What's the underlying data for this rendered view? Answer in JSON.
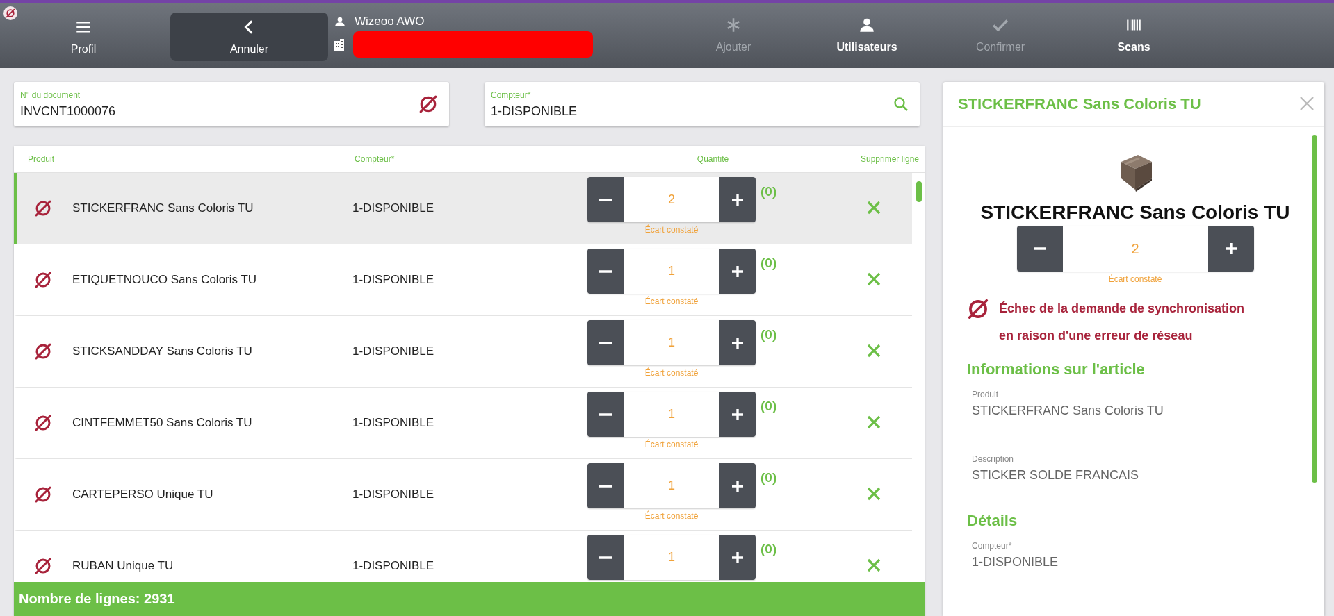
{
  "toolbar": {
    "left": [
      {
        "kind": "menu",
        "label": "Profil",
        "active": false,
        "disabled": false
      },
      {
        "kind": "back",
        "label": "Annuler",
        "active": true,
        "disabled": false
      }
    ],
    "user": {
      "name": "Wizeoo AWO"
    },
    "right": [
      {
        "kind": "add",
        "label": "Ajouter",
        "active": false,
        "disabled": true
      },
      {
        "kind": "users",
        "label": "Utilisateurs",
        "active": false,
        "disabled": false
      },
      {
        "kind": "confirm",
        "label": "Confirmer",
        "active": false,
        "disabled": true
      },
      {
        "kind": "scans",
        "label": "Scans",
        "active": false,
        "disabled": false
      }
    ]
  },
  "document_field": {
    "label": "N° du document",
    "value": "INVCNT1000076",
    "sync_failed": true
  },
  "counter_field": {
    "label": "Compteur*",
    "value": "1-DISPONIBLE"
  },
  "table": {
    "columns": [
      "Produit",
      "Compteur*",
      "Quantité",
      "Supprimer ligne"
    ],
    "rows": [
      {
        "product": "STICKERFRANC Sans Coloris TU",
        "counter": "1-DISPONIBLE",
        "quantity": "2",
        "note": "Écart constaté",
        "count": "(0)",
        "selected": true,
        "sync_failed": true
      },
      {
        "product": "ETIQUETNOUCO Sans Coloris TU",
        "counter": "1-DISPONIBLE",
        "quantity": "1",
        "note": "Écart constaté",
        "count": "(0)",
        "selected": false,
        "sync_failed": true
      },
      {
        "product": "STICKSANDDAY Sans Coloris TU",
        "counter": "1-DISPONIBLE",
        "quantity": "1",
        "note": "Écart constaté",
        "count": "(0)",
        "selected": false,
        "sync_failed": true
      },
      {
        "product": "CINTFEMMET50 Sans Coloris TU",
        "counter": "1-DISPONIBLE",
        "quantity": "1",
        "note": "Écart constaté",
        "count": "(0)",
        "selected": false,
        "sync_failed": true
      },
      {
        "product": "CARTEPERSO Unique TU",
        "counter": "1-DISPONIBLE",
        "quantity": "1",
        "note": "Écart constaté",
        "count": "(0)",
        "selected": false,
        "sync_failed": true
      },
      {
        "product": "RUBAN Unique TU",
        "counter": "1-DISPONIBLE",
        "quantity": "1",
        "count": "(0)",
        "selected": false,
        "sync_failed": true
      }
    ],
    "footer": "Nombre de lignes: 2931"
  },
  "detail": {
    "title": "STICKERFRANC Sans Coloris TU",
    "name": "STICKERFRANC Sans Coloris TU",
    "quantity": "2",
    "note": "Écart constaté",
    "sync_failed": true,
    "error": "Échec de la demande de synchronisation en raison d'une erreur de réseau",
    "sections": [
      {
        "heading": "Informations sur l'article",
        "fields": [
          {
            "label": "Produit",
            "value": "STICKERFRANC Sans Coloris TU"
          },
          {
            "label": "Description",
            "value": "STICKER SOLDE FRANCAIS"
          }
        ]
      },
      {
        "heading": "Détails",
        "fields": [
          {
            "label": "Compteur*",
            "value": "1-DISPONIBLE"
          }
        ]
      }
    ]
  }
}
